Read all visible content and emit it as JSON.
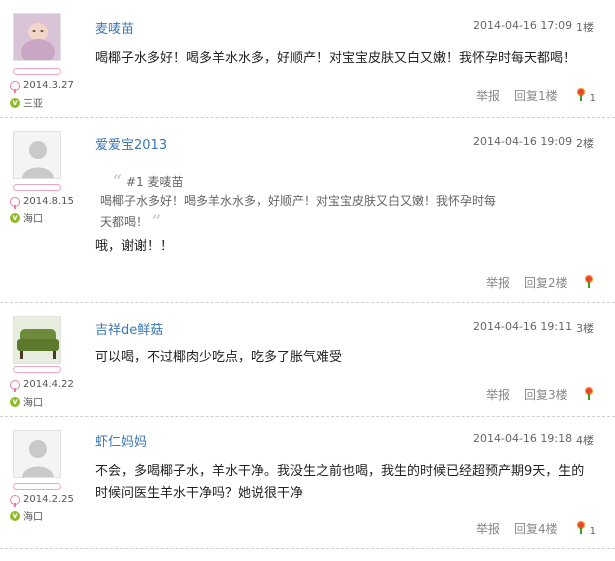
{
  "posts": [
    {
      "name": "麦唛苗",
      "date": "2014.3.27",
      "location": "三亚",
      "time": "2014-04-16 17:09",
      "floor": "1楼",
      "content": [
        "喝椰子水多好！喝多羊水水多，好顺产！对宝宝皮肤又白又嫩！我怀孕时每天都喝！"
      ],
      "report": "举报",
      "reply": "回复1楼",
      "flowers": "1"
    },
    {
      "name": "爱爱宝2013",
      "date": "2014.8.15",
      "location": "海口",
      "time": "2014-04-16 19:09",
      "floor": "2楼",
      "quote_author": "#1 麦唛苗",
      "quote_lines": [
        "喝椰子水多好！喝多羊水水多，好顺产！对宝宝皮肤又白又嫩！我怀孕时每",
        "天都喝！"
      ],
      "content": [
        "哦，谢谢！！"
      ],
      "report": "举报",
      "reply": "回复2楼"
    },
    {
      "name": "吉祥de鲜菇",
      "date": "2014.4.22",
      "location": "海口",
      "time": "2014-04-16 19:11",
      "floor": "3楼",
      "content": [
        "可以喝，不过椰肉少吃点，吃多了胀气难受"
      ],
      "report": "举报",
      "reply": "回复3楼"
    },
    {
      "name": "虾仁妈妈",
      "date": "2014.2.25",
      "location": "海口",
      "time": "2014-04-16 19:18",
      "floor": "4楼",
      "content": [
        "不会，多喝椰子水，羊水干净。我没生之前也喝，我生的时候已经超预产期9天，生的",
        "时候问医生羊水干净吗？她说很干净"
      ],
      "report": "举报",
      "reply": "回复4楼",
      "flowers": "1"
    }
  ],
  "icons": {
    "avatar_1": "baby-photo",
    "avatar_default": "default-user-silhouette",
    "avatar_3": "green-sofa-photo",
    "gender": "female-icon",
    "location": "location-badge-icon",
    "flower": "flower-icon"
  },
  "colors": {
    "name_link": "#3b77b5",
    "level_border": "#f2a6bd",
    "location_badge": "#8dbb2a",
    "flower": "#e9442e"
  }
}
